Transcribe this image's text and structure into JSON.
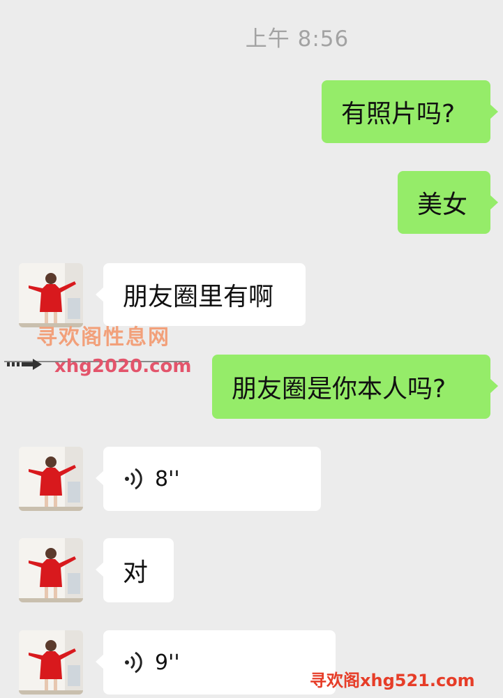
{
  "chat": {
    "timestamp": "上午 8:56",
    "messages": [
      {
        "text": "有照片吗?"
      },
      {
        "text": "美女"
      },
      {
        "text": "朋友圈里有啊"
      },
      {
        "text": "朋友圈是你本人吗?"
      },
      {
        "duration": "8''"
      },
      {
        "text": "对"
      },
      {
        "duration": "9''"
      }
    ]
  },
  "watermark": {
    "site_name": "寻欢阁性息网",
    "site_url": "xhg2020.com",
    "bottom": "寻欢阁xhg521.com"
  },
  "colors": {
    "background": "#ececec",
    "outgoing_bubble": "#95ec69",
    "incoming_bubble": "#ffffff",
    "timestamp_text": "#a3a3a3"
  },
  "icons": {
    "voice": "voice-wave-icon",
    "avatar": "avatar-red-dress-photo"
  }
}
